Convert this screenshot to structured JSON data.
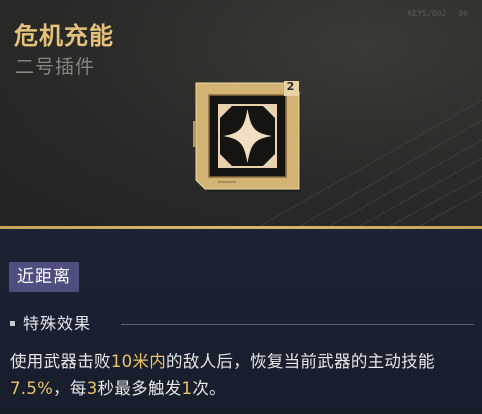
{
  "item": {
    "name": "危机充能",
    "category": "二号插件",
    "tier": "2",
    "corner_code": "KEYS/002",
    "corner_num": "06"
  },
  "range_tag": "近距离",
  "effect": {
    "heading": "特殊效果",
    "parts": [
      "使用武器击败",
      "10米内",
      "的敌人后，恢复当前武器的主动技能",
      "7.5%",
      "，每",
      "3",
      "秒最多触发",
      "1",
      "次。"
    ]
  },
  "colors": {
    "title_gold": "#e4c27a",
    "highlight": "#e9c468",
    "tag_bg": "#4e4e80",
    "divider_gold": "#d8b872",
    "panel_navy": "#1c2333"
  },
  "icons": {
    "chip": "plugin-chip-icon",
    "emblem": "four-point-star-icon"
  }
}
